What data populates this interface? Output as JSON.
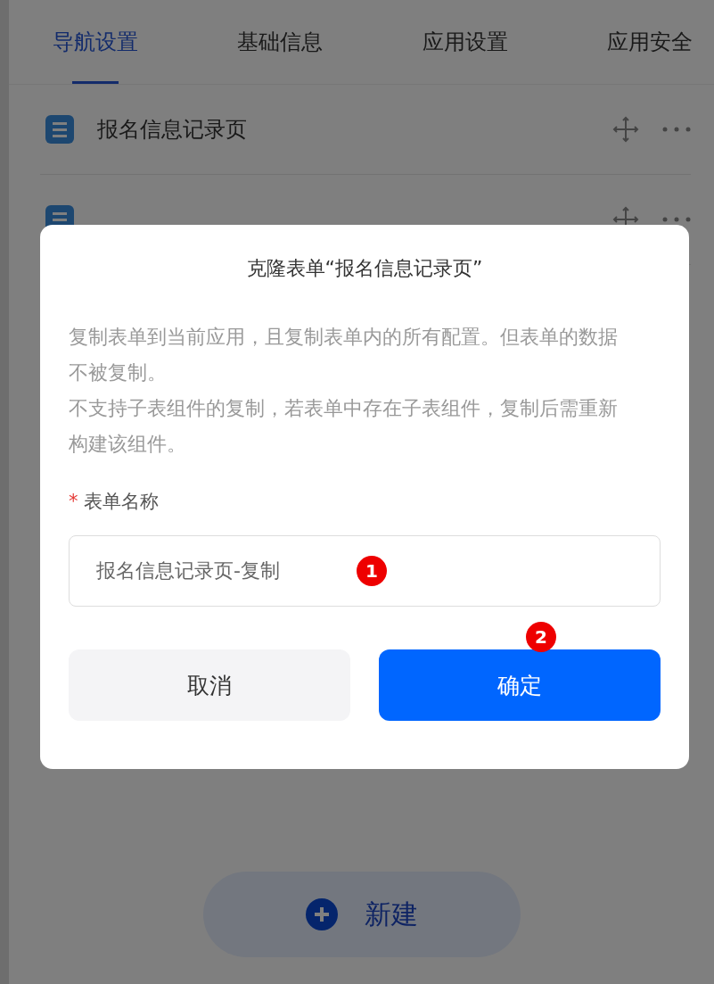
{
  "tabs": [
    {
      "label": "导航设置",
      "selected": true
    },
    {
      "label": "基础信息",
      "selected": false
    },
    {
      "label": "应用设置",
      "selected": false
    },
    {
      "label": "应用安全",
      "selected": false
    }
  ],
  "nav_items": [
    {
      "kind": "titled",
      "title": "报名信息记录页"
    },
    {
      "kind": "covered"
    }
  ],
  "new_button": {
    "label": "新建"
  },
  "dialog": {
    "title": "克隆表单“报名信息记录页”",
    "description": [
      "复制表单到当前应用，且复制表单内的所有配置。但表单的数据不被复制。",
      "不支持子表组件的复制，若表单中存在子表组件，复制后需重新构建该组件。"
    ],
    "field": {
      "label": "表单名称",
      "required_mark": "*",
      "value": "报名信息记录页-复制"
    },
    "buttons": [
      {
        "label": "取消",
        "kind": "secondary"
      },
      {
        "label": "确定",
        "kind": "primary"
      }
    ]
  },
  "annotations": [
    "1",
    "2"
  ]
}
